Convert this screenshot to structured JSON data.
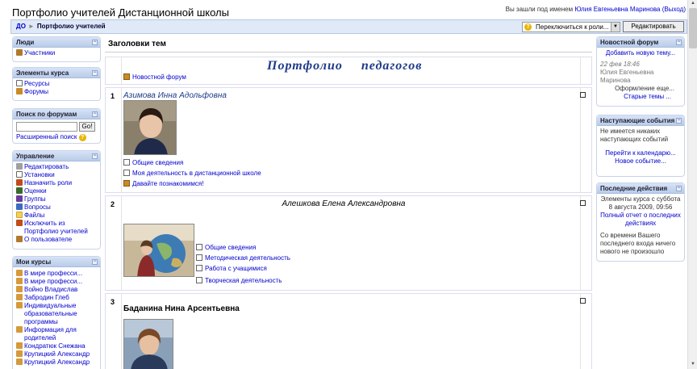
{
  "header": {
    "site_title": "Портфолио учителей Дистанционной школы",
    "login_prefix": "Вы зашли под именем",
    "user_name": "Юлия Евгеньевна Маринова",
    "logout": "(Выход)"
  },
  "navbar": {
    "crumb_home": "ДО",
    "crumb_current": "Портфолио учителей",
    "switch_role": "Переключиться к роли...",
    "edit_button": "Редактировать"
  },
  "left": {
    "people": {
      "title": "Люди",
      "items": [
        "Участники"
      ]
    },
    "course_elements": {
      "title": "Элементы курса",
      "items": [
        "Ресурсы",
        "Форумы"
      ]
    },
    "forum_search": {
      "title": "Поиск по форумам",
      "go": "Go!",
      "advanced": "Расширенный поиск"
    },
    "admin": {
      "title": "Управление",
      "items": [
        "Редактировать",
        "Установки",
        "Назначить роли",
        "Оценки",
        "Группы",
        "Вопросы",
        "Файлы",
        "Исключить из Портфолио учителей",
        "О пользователе"
      ]
    },
    "my_courses": {
      "title": "Мои курсы",
      "items": [
        "В мире професси...",
        "В мире професси...",
        "Войно Владислав",
        "Забродин Глеб",
        "Индивидуальные образовательные программы",
        "Информация для родителей",
        "Кондратюк Снежана",
        "Крупицкий Александр",
        "Крупицкий Александр"
      ]
    }
  },
  "main": {
    "topics_title": "Заголовки тем",
    "portfolio_title": "Портфолио педагогов",
    "news_forum": "Новостной форум",
    "sections": [
      {
        "num": "1",
        "teacher": "Азимова Инна Адольфовна",
        "links": [
          "Общие сведения",
          "Моя деятельность в дистанционной школе",
          "Давайте познакомимся!"
        ]
      },
      {
        "num": "2",
        "teacher": "Алешкова Елена Александровна",
        "links": [
          "Общие сведения",
          "Методическая деятельность",
          "Работа с учащимися",
          "Творческая деятельность"
        ]
      },
      {
        "num": "3",
        "teacher": "Баданина Нина Арсентьевна",
        "links": []
      }
    ]
  },
  "right": {
    "news": {
      "title": "Новостной форум",
      "add": "Добавить новую тему...",
      "date": "22 фев 18:46",
      "author": "Юлия Евгеньевна Маринова",
      "post": "Оформление еще...",
      "older": "Старые темы ..."
    },
    "upcoming": {
      "title": "Наступающие события",
      "none": "Не имеется никаких наступающих событий",
      "calendar": "Перейти к календарю...",
      "new_event": "Новое событие..."
    },
    "recent": {
      "title": "Последние действия",
      "since": "Элементы курса с суббота 8 августа 2009, 09:56",
      "full_report": "Полный отчет о последних действиях",
      "nothing": "Со времени Вашего последнего входа ничего нового не произошло"
    }
  },
  "colors": {
    "accent": "#b9cce9",
    "link": "#0000cc",
    "title": "#1e3a8a"
  }
}
